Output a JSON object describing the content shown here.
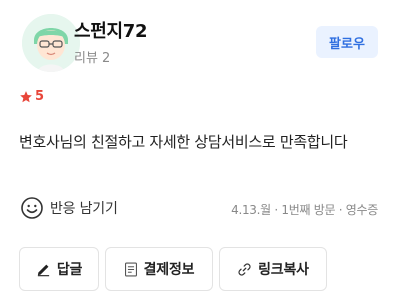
{
  "reviewer": {
    "name": "스펀지72",
    "review_count": "리뷰 2",
    "follow_label": "팔로우"
  },
  "rating": {
    "value": "5",
    "star_color": "#e8463a"
  },
  "review": {
    "text": "변호사님의 친절하고 자세한 상담서비스로 만족합니다"
  },
  "reaction": {
    "label": "반응 남기기",
    "icon": "smiley-icon"
  },
  "visit": {
    "meta": "4.13.월 · 1번째 방문 · 영수증"
  },
  "actions": {
    "reply_label": "답글",
    "payment_label": "결제정보",
    "link_copy_label": "링크복사"
  },
  "colors": {
    "accent": "#2f6fe0",
    "follow_bg": "#eaf2ff"
  }
}
